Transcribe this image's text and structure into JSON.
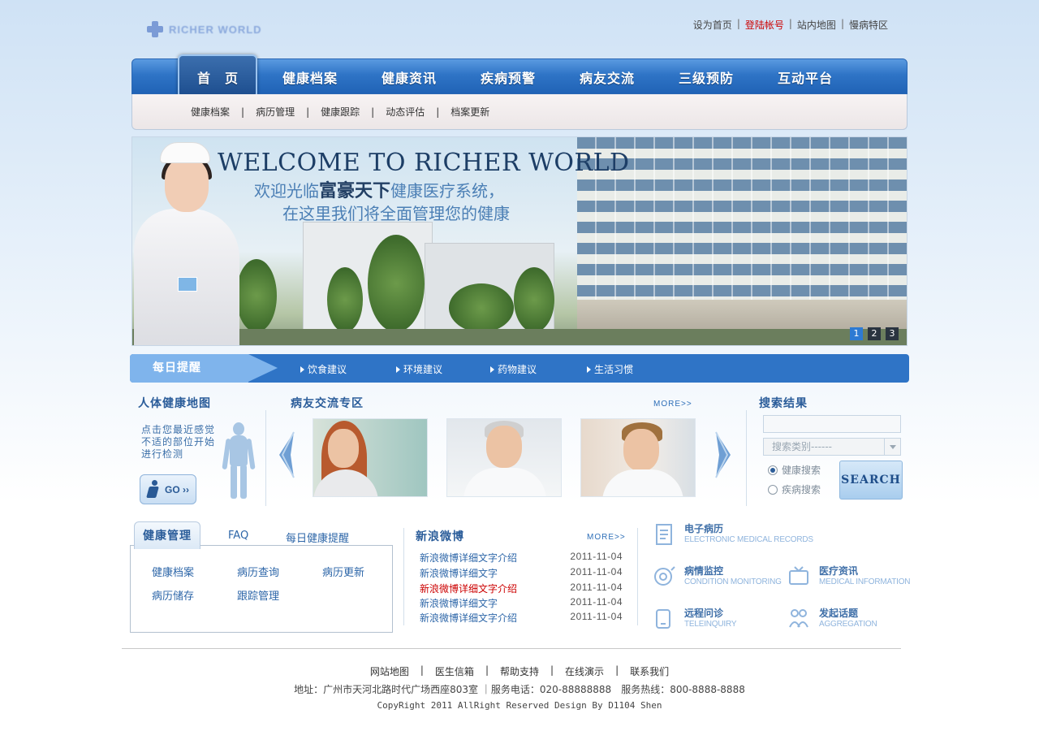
{
  "header": {
    "logo_text": "RICHER WORLD",
    "links": [
      {
        "label": "设为首页",
        "hot": false
      },
      {
        "label": "登陆帐号",
        "hot": true
      },
      {
        "label": "站内地图",
        "hot": false
      },
      {
        "label": "慢病特区",
        "hot": false
      }
    ]
  },
  "nav": {
    "items": [
      "首　页",
      "健康档案",
      "健康资讯",
      "疾病预警",
      "病友交流",
      "三级预防",
      "互动平台"
    ],
    "active": "首　页"
  },
  "subnav": [
    "健康档案",
    "病历管理",
    "健康跟踪",
    "动态评估",
    "档案更新"
  ],
  "banner": {
    "title_en": "WELCOME TO RICHER WORLD",
    "line1_pre": "欢迎光临",
    "line1_bold": "富豪天下",
    "line1_post": "健康医疗系统，",
    "line2": "在这里我们将全面管理您的健康",
    "pages": [
      "1",
      "2",
      "3"
    ],
    "current_page": "1"
  },
  "daily": {
    "label": "每日提醒",
    "items": [
      "饮食建议",
      "环境建议",
      "药物建议",
      "生活习惯"
    ]
  },
  "bodymap": {
    "title": "人体健康地图",
    "text": "点击您最近感觉不适的部位开始进行检测",
    "go_label": "GO"
  },
  "patients": {
    "title": "病友交流专区",
    "more": "MORE>>"
  },
  "search": {
    "title": "搜索结果",
    "input_value": "",
    "category_placeholder": "搜索类别------",
    "options": [
      "健康搜索",
      "疾病搜索"
    ],
    "selected": "健康搜索",
    "button": "SEARCH"
  },
  "health_mgmt": {
    "tabs": [
      "健康管理",
      "FAQ",
      "每日健康提醒"
    ],
    "links": [
      "健康档案",
      "病历查询",
      "病历更新",
      "病历储存",
      "跟踪管理"
    ]
  },
  "weibo": {
    "title": "新浪微博",
    "more": "MORE>>",
    "items": [
      {
        "title": "新浪微博详细文字介绍",
        "date": "2011-11-04",
        "hot": false
      },
      {
        "title": "新浪微博详细文字",
        "date": "2011-11-04",
        "hot": false
      },
      {
        "title": "新浪微博详细文字介绍",
        "date": "2011-11-04",
        "hot": true
      },
      {
        "title": "新浪微博详细文字",
        "date": "2011-11-04",
        "hot": false
      },
      {
        "title": "新浪微博详细文字介绍",
        "date": "2011-11-04",
        "hot": false
      }
    ]
  },
  "services": [
    {
      "cn": "电子病历",
      "en": "ELECTRONIC MEDICAL RECORDS",
      "icon": "document-icon"
    },
    {
      "cn": "病情监控",
      "en": "CONDITION MONITORING",
      "icon": "monitor-icon"
    },
    {
      "cn": "医疗资讯",
      "en": "MEDICAL INFORMATION",
      "icon": "tv-icon"
    },
    {
      "cn": "远程问诊",
      "en": "TELEINQUIRY",
      "icon": "phone-icon"
    },
    {
      "cn": "发起话题",
      "en": "AGGREGATION",
      "icon": "people-icon"
    }
  ],
  "footer": {
    "links": [
      "网站地图",
      "医生信箱",
      "帮助支持",
      "在线演示",
      "联系我们"
    ],
    "address": "地址：广州市天河北路时代广场西座803室 ｜服务电话：020-88888888　服务热线：800-8888-8888",
    "copyright": "CopyRight 2011 AllRight Reserved Design By D1104 Shen"
  },
  "colors": {
    "nav_blue": "#2f74c6",
    "link_blue": "#2d66a8",
    "hot_red": "#cc0000"
  }
}
